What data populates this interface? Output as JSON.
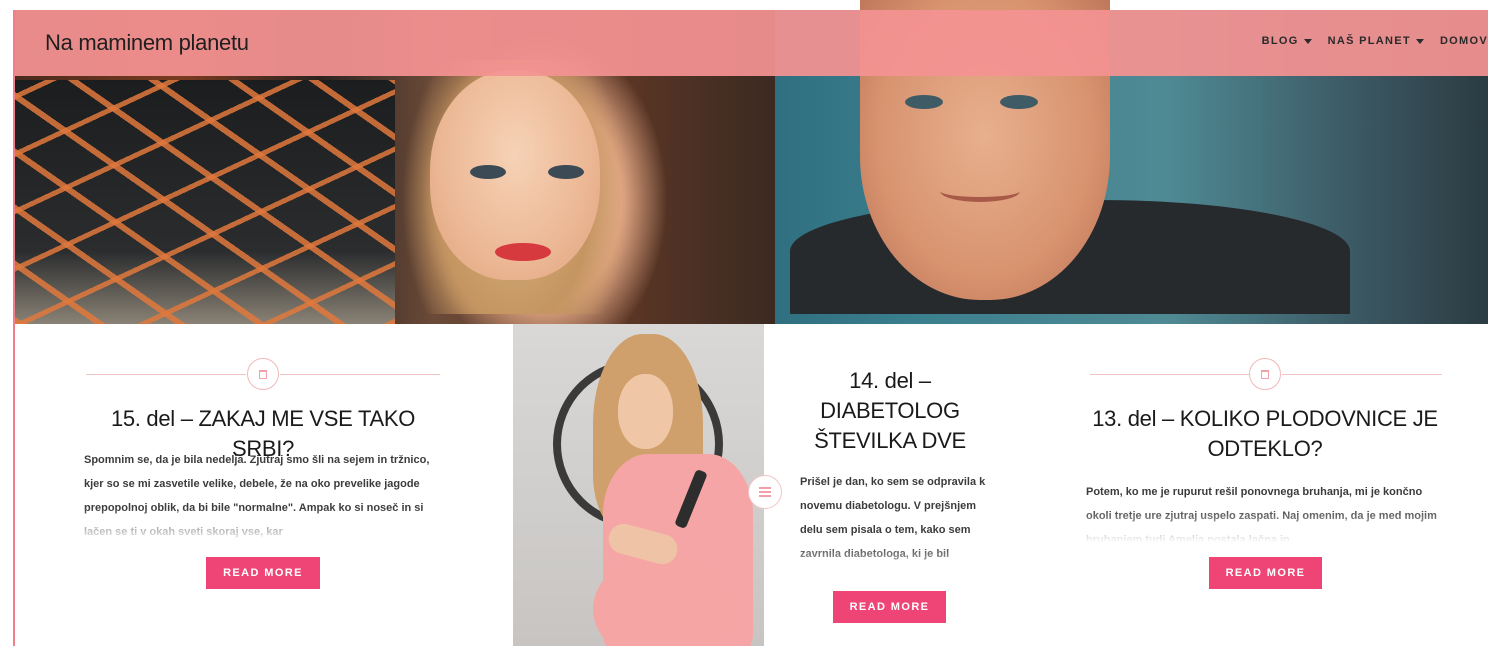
{
  "site": {
    "brand": "Na maminem planetu"
  },
  "nav": {
    "items": [
      {
        "label": "BLOG",
        "has_dropdown": true
      },
      {
        "label": "NAŠ PLANET",
        "has_dropdown": true
      },
      {
        "label": "DOMOV",
        "has_dropdown": false
      }
    ]
  },
  "posts": [
    {
      "title": "15. del – ZAKAJ ME VSE TAKO SRBI?",
      "excerpt": "Spomnim se, da je bila nedelja. Zjutraj smo šli na sejem in tržnico, kjer so se mi zasvetile velike, debele, že na oko prevelike jagode prepopolnoj oblik, da bi bile \"normalne\". Ampak ko si noseč in si lačen se ti v okah sveti skoraj vse, kar",
      "button": "READ MORE",
      "icon": "post-format-icon"
    },
    {
      "title": "14. del – DIABETOLOG ŠTEVILKA DVE",
      "excerpt": "Prišel je dan, ko sem se odpravila k novemu diabetologu. V prejšnjem delu sem pisala o tem, kako sem zavrnila diabetologa, ki je bil",
      "button": "READ MORE",
      "icon": "post-format-icon"
    },
    {
      "title": "13. del – KOLIKO PLODOVNICE JE ODTEKLO?",
      "excerpt": "Potem, ko me je rupurut rešil ponovnega bruhanja, mi je končno okoli tretje ure zjutraj uspelo zaspati. Naj omenim, da je med mojim bruhanjem tudi Amelia postala lačna in",
      "button": "READ MORE",
      "icon": "post-format-icon"
    }
  ],
  "colors": {
    "navbar": "#f49292",
    "button": "#ee4576",
    "accent_line": "#f2c4c4"
  }
}
